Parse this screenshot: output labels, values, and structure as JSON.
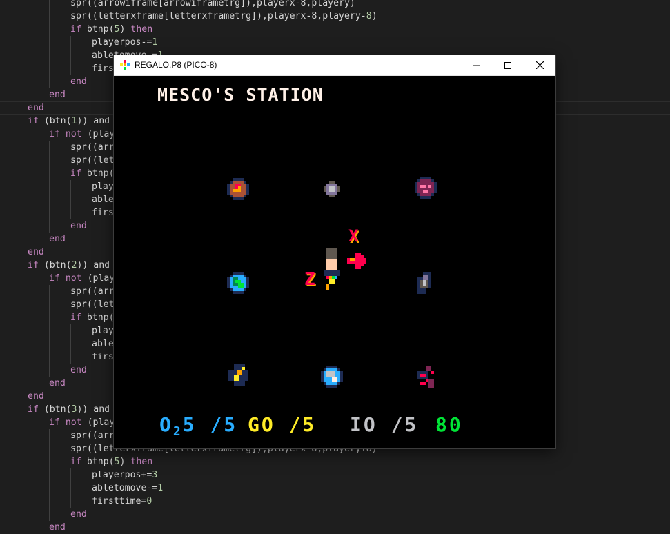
{
  "editor": {
    "lines": [
      {
        "indent": 3,
        "parts": [
          {
            "t": "spr((arrowiframe[arrowiframetrg]),playerx-8,playery)",
            "c": "txt"
          }
        ]
      },
      {
        "indent": 3,
        "parts": [
          {
            "t": "spr((letterxframe[letterxframetrg]),playerx-8,playery-",
            "c": "txt"
          },
          {
            "t": "8",
            "c": "num"
          },
          {
            "t": ")",
            "c": "txt"
          }
        ]
      },
      {
        "indent": 3,
        "parts": [
          {
            "t": "if ",
            "c": "kw"
          },
          {
            "t": "btnp(",
            "c": "txt"
          },
          {
            "t": "5",
            "c": "num"
          },
          {
            "t": ") ",
            "c": "txt"
          },
          {
            "t": "then",
            "c": "kw"
          }
        ]
      },
      {
        "indent": 4,
        "parts": [
          {
            "t": "playerpos-=",
            "c": "txt"
          },
          {
            "t": "1",
            "c": "num"
          }
        ]
      },
      {
        "indent": 4,
        "parts": [
          {
            "t": "abletomove-=",
            "c": "txt"
          },
          {
            "t": "1",
            "c": "num"
          }
        ]
      },
      {
        "indent": 4,
        "parts": [
          {
            "t": "first",
            "c": "txt"
          }
        ]
      },
      {
        "indent": 3,
        "parts": [
          {
            "t": "end",
            "c": "kw"
          }
        ]
      },
      {
        "indent": 2,
        "parts": [
          {
            "t": "end",
            "c": "kw"
          }
        ]
      },
      {
        "indent": 1,
        "parts": [
          {
            "t": "end",
            "c": "kw"
          }
        ]
      },
      {
        "indent": 1,
        "parts": [
          {
            "t": "if ",
            "c": "kw"
          },
          {
            "t": "(btn(",
            "c": "txt"
          },
          {
            "t": "1",
            "c": "num"
          },
          {
            "t": ")) and ",
            "c": "txt"
          }
        ]
      },
      {
        "indent": 2,
        "parts": [
          {
            "t": "if not ",
            "c": "kw"
          },
          {
            "t": "(playe",
            "c": "txt"
          }
        ]
      },
      {
        "indent": 3,
        "parts": [
          {
            "t": "spr((arro",
            "c": "txt"
          }
        ]
      },
      {
        "indent": 3,
        "parts": [
          {
            "t": "spr((lett",
            "c": "txt"
          }
        ]
      },
      {
        "indent": 3,
        "parts": [
          {
            "t": "if ",
            "c": "kw"
          },
          {
            "t": "btnp(",
            "c": "txt"
          }
        ]
      },
      {
        "indent": 4,
        "parts": [
          {
            "t": "playe",
            "c": "txt"
          }
        ]
      },
      {
        "indent": 4,
        "parts": [
          {
            "t": "ablet",
            "c": "txt"
          }
        ]
      },
      {
        "indent": 4,
        "parts": [
          {
            "t": "first",
            "c": "txt"
          }
        ]
      },
      {
        "indent": 3,
        "parts": [
          {
            "t": "end",
            "c": "kw"
          }
        ]
      },
      {
        "indent": 2,
        "parts": [
          {
            "t": "end",
            "c": "kw"
          }
        ]
      },
      {
        "indent": 1,
        "parts": [
          {
            "t": "end",
            "c": "kw"
          }
        ]
      },
      {
        "indent": 1,
        "parts": [
          {
            "t": "if ",
            "c": "kw"
          },
          {
            "t": "(btn(",
            "c": "txt"
          },
          {
            "t": "2",
            "c": "num"
          },
          {
            "t": ")) and ",
            "c": "txt"
          }
        ]
      },
      {
        "indent": 2,
        "parts": [
          {
            "t": "if not ",
            "c": "kw"
          },
          {
            "t": "(playe",
            "c": "txt"
          }
        ]
      },
      {
        "indent": 3,
        "parts": [
          {
            "t": "spr((arro",
            "c": "txt"
          }
        ]
      },
      {
        "indent": 3,
        "parts": [
          {
            "t": "spr((lett",
            "c": "txt"
          }
        ]
      },
      {
        "indent": 3,
        "parts": [
          {
            "t": "if ",
            "c": "kw"
          },
          {
            "t": "btnp(",
            "c": "txt"
          }
        ]
      },
      {
        "indent": 4,
        "parts": [
          {
            "t": "playe",
            "c": "txt"
          }
        ]
      },
      {
        "indent": 4,
        "parts": [
          {
            "t": "ablet",
            "c": "txt"
          }
        ]
      },
      {
        "indent": 4,
        "parts": [
          {
            "t": "first",
            "c": "txt"
          }
        ]
      },
      {
        "indent": 3,
        "parts": [
          {
            "t": "end",
            "c": "kw"
          }
        ]
      },
      {
        "indent": 2,
        "parts": [
          {
            "t": "end",
            "c": "kw"
          }
        ]
      },
      {
        "indent": 1,
        "parts": [
          {
            "t": "end",
            "c": "kw"
          }
        ]
      },
      {
        "indent": 1,
        "parts": [
          {
            "t": "if ",
            "c": "kw"
          },
          {
            "t": "(btn(",
            "c": "txt"
          },
          {
            "t": "3",
            "c": "num"
          },
          {
            "t": ")) and ",
            "c": "txt"
          }
        ]
      },
      {
        "indent": 2,
        "parts": [
          {
            "t": "if not ",
            "c": "kw"
          },
          {
            "t": "(playe",
            "c": "txt"
          }
        ]
      },
      {
        "indent": 3,
        "parts": [
          {
            "t": "spr((arro",
            "c": "txt"
          }
        ]
      },
      {
        "indent": 3,
        "parts": [
          {
            "t": "spr((letterxframe[letterxframetrg]),playerx-8,playery+8)",
            "c": "txt"
          }
        ]
      },
      {
        "indent": 3,
        "parts": [
          {
            "t": "if ",
            "c": "kw"
          },
          {
            "t": "btnp(",
            "c": "txt"
          },
          {
            "t": "5",
            "c": "num"
          },
          {
            "t": ") ",
            "c": "txt"
          },
          {
            "t": "then",
            "c": "kw"
          }
        ]
      },
      {
        "indent": 4,
        "parts": [
          {
            "t": "playerpos+=",
            "c": "txt"
          },
          {
            "t": "3",
            "c": "num"
          }
        ]
      },
      {
        "indent": 4,
        "parts": [
          {
            "t": "abletomove-=",
            "c": "txt"
          },
          {
            "t": "1",
            "c": "num"
          }
        ]
      },
      {
        "indent": 4,
        "parts": [
          {
            "t": "firsttime=",
            "c": "txt"
          },
          {
            "t": "0",
            "c": "num"
          }
        ]
      },
      {
        "indent": 3,
        "parts": [
          {
            "t": "end",
            "c": "kw"
          }
        ]
      },
      {
        "indent": 2,
        "parts": [
          {
            "t": "end",
            "c": "kw"
          }
        ]
      }
    ]
  },
  "window": {
    "title": "REGALO.P8 (PICO-8)",
    "minimize_icon": "minimize-icon",
    "maximize_icon": "maximize-icon",
    "close_icon": "close-icon"
  },
  "game": {
    "station_title": "MESCO'S STATION",
    "letter_x_label": "X",
    "letter_z_label": "Z",
    "hud": {
      "o2_label": "O",
      "o2_sub": "2",
      "o2_value": "5 /5",
      "go_value": "GO /5",
      "io_value": "IO /5",
      "count_value": "80"
    }
  },
  "colors": {
    "editor_bg": "#1e1e1e",
    "keyword": "#c586c0",
    "number": "#b5cea8",
    "pico_white": "#fff1e8",
    "pico_blue": "#29adff",
    "pico_yellow": "#ffec27",
    "pico_gray": "#c2c3c7",
    "pico_green": "#00e436",
    "pico_red": "#ff004d",
    "pico_orange": "#ffa300"
  }
}
